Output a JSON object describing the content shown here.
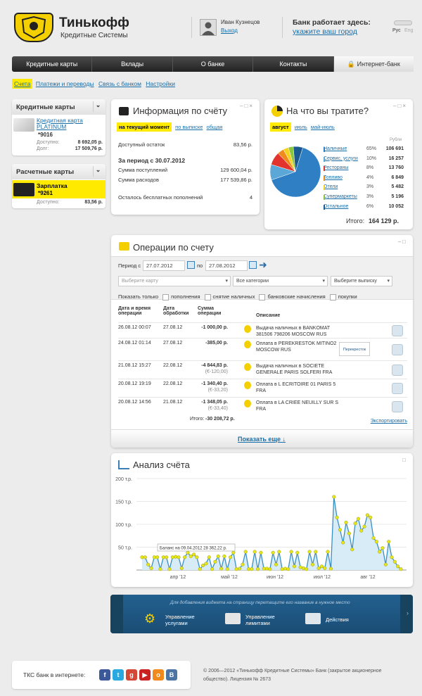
{
  "header": {
    "brand": "Тинькофф",
    "brand_sub": "Кредитные Системы",
    "user_name": "Иван Кузнецов",
    "logout": "Выход",
    "bank_works": "Банк работает здесь:",
    "bank_link": "укажите ваш город",
    "lang_ru": "Рус",
    "lang_en": "Eng"
  },
  "nav": [
    "Кредитные карты",
    "Вклады",
    "О банке",
    "Контакты",
    "Интернет-банк"
  ],
  "subnav": [
    "Счета",
    "Платежи и переводы",
    "Связь с банком",
    "Настройки"
  ],
  "sidebar": {
    "credit_title": "Кредитные карты",
    "credit_card": {
      "name": "Кредитная карта PLATINUM",
      "num": "*9016",
      "avail_label": "Доступно:",
      "avail": "8 692,05 р.",
      "debt_label": "Долг:",
      "debt": "17 509,76 р."
    },
    "settle_title": "Расчетные карты",
    "settle_card": {
      "name": "Зарплатка",
      "num": "*9261",
      "avail_label": "Доступно:",
      "avail": "83,56 р."
    }
  },
  "info": {
    "title": "Информация по счёту",
    "tabs": [
      "на текущий момент",
      "по выписке",
      "общая"
    ],
    "avail_label": "Доступный остаток",
    "avail": "83,56 р.",
    "period": "За период с 30.07.2012",
    "in_label": "Сумма поступлений",
    "in": "129 600,04 р.",
    "out_label": "Сумма расходов",
    "out": "177 539,86 р.",
    "free_label": "Осталось бесплатных пополнений",
    "free": "4"
  },
  "spend": {
    "title": "На что вы тратите?",
    "tabs": [
      "август",
      "июль",
      "май-июль"
    ],
    "col": "Рубли",
    "rows": [
      {
        "name": "Наличные",
        "pct": "65%",
        "val": "106 691",
        "color": "#2f7fc4"
      },
      {
        "name": "Сервис, услуги",
        "pct": "10%",
        "val": "16 257",
        "color": "#5aa7d8"
      },
      {
        "name": "Рестораны",
        "pct": "8%",
        "val": "13 760",
        "color": "#e2342c"
      },
      {
        "name": "Топливо",
        "pct": "4%",
        "val": "6 849",
        "color": "#f08a1c"
      },
      {
        "name": "Отели",
        "pct": "3%",
        "val": "5 482",
        "color": "#f4d21f"
      },
      {
        "name": "Супермаркеты",
        "pct": "3%",
        "val": "5 196",
        "color": "#8cc63e"
      },
      {
        "name": "Остальное",
        "pct": "6%",
        "val": "10 052",
        "color": "#1a5a90"
      }
    ],
    "total_label": "Итого:",
    "total": "164 129 р."
  },
  "ops": {
    "title": "Операции по счету",
    "period_label": "Период с",
    "date_from": "27.07.2012",
    "date_to_label": "по",
    "date_to": "27.08.2012",
    "card_placeholder": "Выберите карту",
    "cat_placeholder": "Все категории",
    "stmt_placeholder": "Выберите выписку",
    "show_only": "Показать только",
    "filters": [
      "пополнения",
      "снятие наличных",
      "банковские начисления",
      "покупки"
    ],
    "cols": [
      "Дата и время операции",
      "Дата обработки",
      "Сумма операции",
      "Описание"
    ],
    "rows": [
      {
        "dt": "26.08.12 00:07",
        "proc": "27.08.12",
        "amt": "-1 000,00 р.",
        "sub": "",
        "desc": "Выдача наличных в BANKOMAT 381506 798206 MOSCOW RUS",
        "logo": ""
      },
      {
        "dt": "24.08.12 01:14",
        "proc": "27.08.12",
        "amt": "-385,00 р.",
        "sub": "",
        "desc": "Оплата в PEREKRESTOK MITINO2 MOSCOW RUS",
        "logo": "Перекресток"
      },
      {
        "dt": "21.08.12 15:27",
        "proc": "22.08.12",
        "amt": "-4 844,83 р.",
        "sub": "(€-120,00)",
        "desc": "Выдача наличных в SOCIETE GENERALE PARIS SOLFERI FRA",
        "logo": ""
      },
      {
        "dt": "20.08.12 19:19",
        "proc": "22.08.12",
        "amt": "-1 340,40 р.",
        "sub": "(€-33,20)",
        "desc": "Оплата в L ECRITOIRE 01 PARIS 5 FRA",
        "logo": ""
      },
      {
        "dt": "20.08.12 14:56",
        "proc": "21.08.12",
        "amt": "-1 348,05 р.",
        "sub": "(€-33,40)",
        "desc": "Оплата в LA CRIEE NEUILLY SUR S FRA",
        "logo": ""
      }
    ],
    "total_label": "Итого:",
    "total": "-30 208,72 р.",
    "export": "Экспортировать",
    "more": "Показать еще ↓"
  },
  "analysis": {
    "title": "Анализ счёта",
    "tooltip": "Баланс на 09.04.2012 28 362,22 р."
  },
  "chart_data": {
    "type": "area",
    "ylabel": "",
    "xlabel": "",
    "ylim": [
      0,
      200
    ],
    "yticks": [
      "200 т.р.",
      "150 т.р.",
      "100 т.р.",
      "50 т.р."
    ],
    "ytick_values": [
      200,
      150,
      100,
      50
    ],
    "xticks": [
      "апр '12",
      "май '12",
      "июн '12",
      "июл '12",
      "авг '12"
    ],
    "values": [
      28,
      28,
      12,
      4,
      28,
      28,
      2,
      28,
      28,
      2,
      28,
      29,
      28,
      4,
      28,
      38,
      30,
      34,
      28,
      2,
      10,
      14,
      28,
      2,
      18,
      30,
      3,
      30,
      2,
      28,
      38,
      2,
      3,
      12,
      40,
      2,
      2,
      40,
      2,
      38,
      3,
      3,
      2,
      38,
      12,
      40,
      2,
      3,
      2,
      40,
      8,
      38,
      6,
      4,
      2,
      40,
      12,
      40,
      4,
      8,
      4,
      40,
      3,
      160,
      115,
      88,
      60,
      104,
      80,
      45,
      102,
      112,
      86,
      95,
      120,
      115,
      70,
      62,
      40,
      48,
      12,
      62,
      28,
      18,
      8,
      2
    ],
    "tooltip": "Баланс на 09.04.2012 28 362,22 р."
  },
  "widgets": {
    "hint": "Для добавления виджета на страницу перетащите его название в нужное место",
    "items": [
      "Управление услугами",
      "Управление лимитами",
      "Действия"
    ]
  },
  "footer": {
    "social_label": "ТКС банк в интернете:",
    "copyright": "© 2006—2012 «Тинькофф Кредитные Системы» Банк (закрытое акционерное общество). Лицензия № 2673"
  }
}
